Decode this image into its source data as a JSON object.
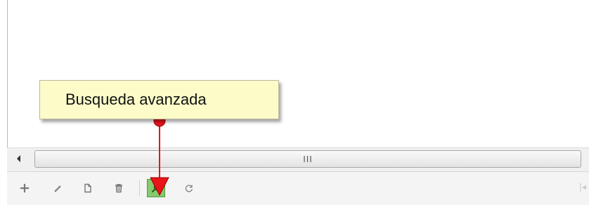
{
  "callout": {
    "text": "Busqueda avanzada"
  },
  "scrollbar": {
    "grip": "III"
  },
  "toolbar": {
    "buttons": [
      {
        "icon": "plus-icon"
      },
      {
        "icon": "pencil-icon"
      },
      {
        "icon": "document-icon"
      },
      {
        "icon": "trash-icon"
      },
      {
        "icon": "search-icon",
        "active": true
      },
      {
        "icon": "refresh-icon"
      }
    ],
    "pager_edge": "|◂"
  },
  "colors": {
    "callout_bg": "#fdfcc9",
    "search_active_bg": "#86c96e",
    "pointer": "#e8141a"
  }
}
